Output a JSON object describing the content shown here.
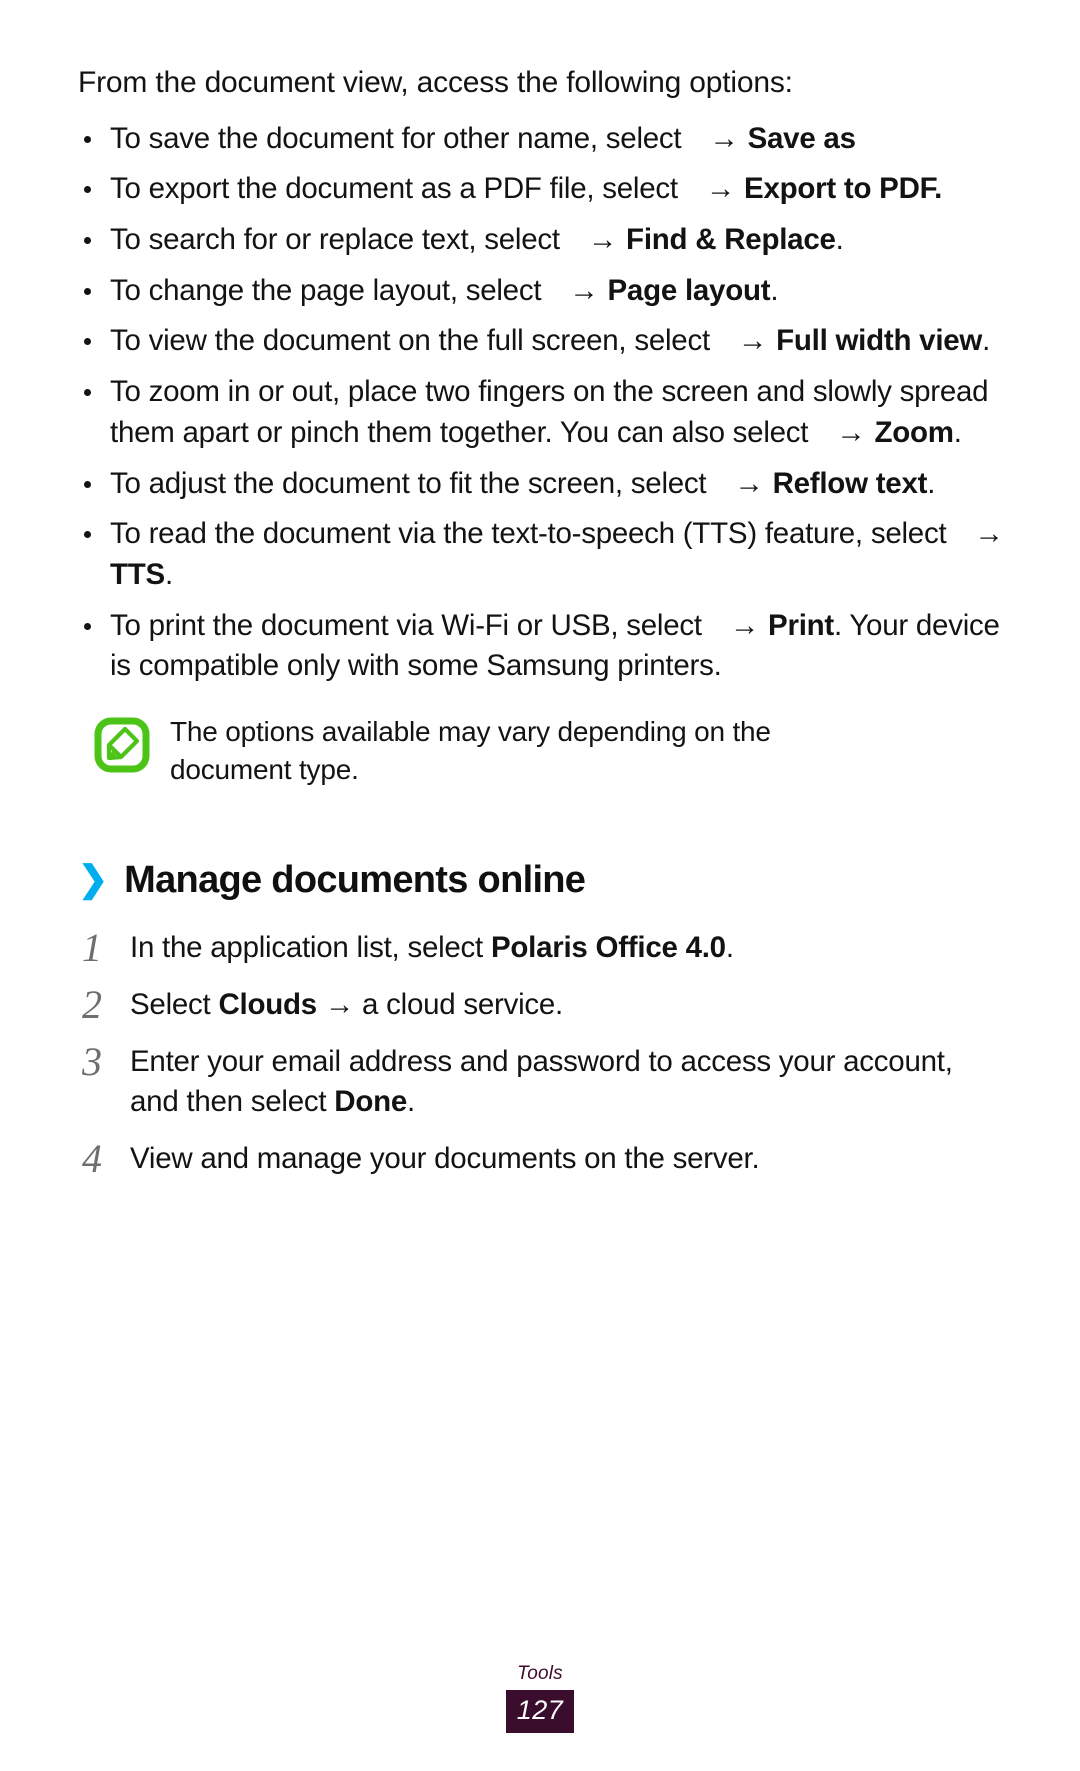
{
  "intro": "From the document view, access the following options:",
  "bullets": [
    {
      "pre": "To save the document for other name, select",
      "arrow": "→",
      "bold": "Save as",
      "post": ""
    },
    {
      "pre": "To export the document as a PDF file, select",
      "arrow": "→",
      "bold": "Export to PDF",
      "post": "."
    },
    {
      "pre": "To search for or replace text, select",
      "arrow": "→",
      "bold": "Find & Replace",
      "post": "."
    },
    {
      "pre": "To change the page layout, select",
      "arrow": "→",
      "bold": "Page layout",
      "post": "."
    },
    {
      "pre": "To view the document on the full screen, select",
      "arrow": "→",
      "bold": "Full width view",
      "post": "."
    },
    {
      "pre": "To zoom in or out, place two fingers on the screen and slowly spread them apart or pinch them together. You can also select",
      "arrow": "→",
      "bold": "Zoom",
      "post": "."
    },
    {
      "pre": "To adjust the document to fit the screen, select",
      "arrow": "→",
      "bold": "Reflow text",
      "post": "."
    },
    {
      "pre": "To read the document via the text-to-speech (TTS) feature, select",
      "arrow": "→",
      "bold": "TTS",
      "post": "."
    },
    {
      "pre": "To print the document via Wi-Fi or USB, select",
      "arrow": "→",
      "bold": "Print",
      "post": ". Your device is compatible only with some Samsung printers."
    }
  ],
  "note": {
    "icon": "note-pen-icon",
    "icon_color": "#4cc417",
    "text": "The options available may vary depending on the document type."
  },
  "section": {
    "marker": "❯",
    "marker_color": "#00adef",
    "title": "Manage documents online"
  },
  "steps": [
    {
      "num": "1",
      "pre": "In the application list, select ",
      "bold": "Polaris Office 4.0",
      "post": "."
    },
    {
      "num": "2",
      "pre": "Select ",
      "bold": "Clouds",
      "post": " → a cloud service."
    },
    {
      "num": "3",
      "pre": "Enter your email address and password to access your account, and then select ",
      "bold": "Done",
      "post": "."
    },
    {
      "num": "4",
      "pre": "View and manage your documents on the server.",
      "bold": "",
      "post": ""
    }
  ],
  "footer": {
    "label": "Tools",
    "page": "127",
    "page_bg": "#3a0d2c"
  }
}
